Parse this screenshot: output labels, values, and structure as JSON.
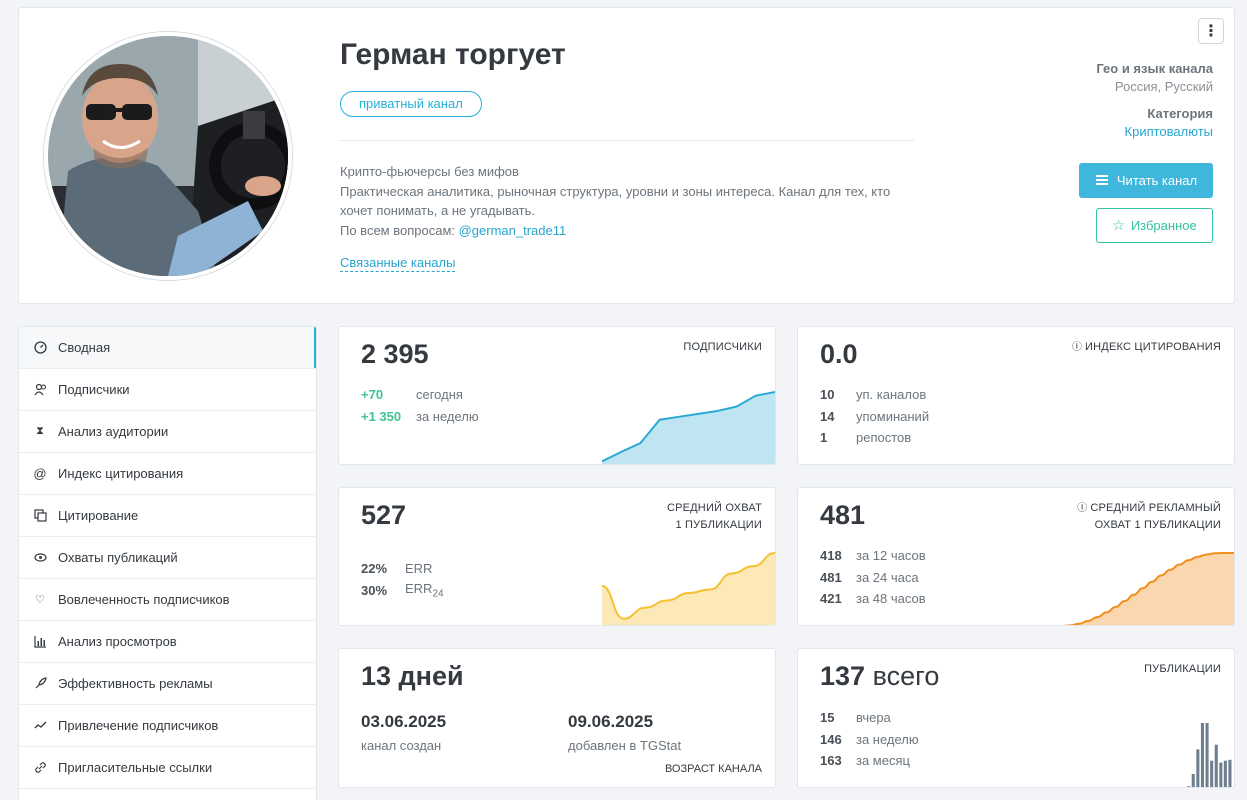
{
  "channel": {
    "title": "Герман торгует",
    "badge": "приватный канал",
    "desc_line1": "Крипто-фьючерсы без мифов",
    "desc_line2": "Практическая аналитика, рыночная структура, уровни и зоны интереса. Канал для тех, кто хочет понимать, а не угадывать.",
    "desc_contact_prefix": "По всем вопросам: ",
    "desc_contact_link": "@german_trade11",
    "related_link": "Связанные каналы",
    "geo_label": "Гео и язык канала",
    "geo_value": "Россия, Русский",
    "category_label": "Категория",
    "category_value": "Криптовалюты",
    "read_button": "Читать канал",
    "fav_button": "Избранное"
  },
  "sidebar": {
    "items": [
      {
        "label": "Сводная",
        "icon": "dashboard-icon"
      },
      {
        "label": "Подписчики",
        "icon": "users-icon"
      },
      {
        "label": "Анализ аудитории",
        "icon": "hourglass-icon"
      },
      {
        "label": "Индекс цитирования",
        "icon": "at-icon"
      },
      {
        "label": "Цитирование",
        "icon": "copy-icon"
      },
      {
        "label": "Охваты публикаций",
        "icon": "eye-icon"
      },
      {
        "label": "Вовлеченность подписчиков",
        "icon": "heart-icon"
      },
      {
        "label": "Анализ просмотров",
        "icon": "bar-chart-icon"
      },
      {
        "label": "Эффективность рекламы",
        "icon": "rocket-icon"
      },
      {
        "label": "Привлечение подписчиков",
        "icon": "trend-icon"
      },
      {
        "label": "Пригласительные ссылки",
        "icon": "link-icon"
      }
    ]
  },
  "subscribers": {
    "value": "2 395",
    "title": "подписчики",
    "rows": [
      {
        "n": "+70",
        "t": "сегодня"
      },
      {
        "n": "+1 350",
        "t": "за неделю"
      }
    ],
    "trend": [
      0.05,
      0.18,
      0.3,
      0.62,
      0.66,
      0.7,
      0.74,
      0.8,
      0.95,
      1.0
    ]
  },
  "citation": {
    "value": "0.0",
    "title": "индекс цитирования",
    "rows": [
      {
        "n": "10",
        "t": "уп. каналов"
      },
      {
        "n": "14",
        "t": "упоминаний"
      },
      {
        "n": "1",
        "t": "репостов"
      }
    ]
  },
  "reach": {
    "value": "527",
    "title_line1": "средний охват",
    "title_line2": "1 публикации",
    "rows": [
      {
        "n": "22%",
        "t": "ERR"
      },
      {
        "n": "30%",
        "t": "ERR",
        "sub": "24"
      }
    ],
    "trend": [
      0.55,
      0.1,
      0.25,
      0.35,
      0.45,
      0.5,
      0.72,
      0.82,
      1.0
    ]
  },
  "ad_reach": {
    "value": "481",
    "title_line1": "средний рекламный",
    "title_line2": "охват 1 публикации",
    "rows": [
      {
        "n": "418",
        "t": "за 12 часов"
      },
      {
        "n": "481",
        "t": "за 24 часа"
      },
      {
        "n": "421",
        "t": "за 48 часов"
      }
    ]
  },
  "age": {
    "value": "13 дней",
    "created_date": "03.06.2025",
    "created_label": "канал создан",
    "added_date": "09.06.2025",
    "added_label": "добавлен в TGStat",
    "title": "возраст канала"
  },
  "posts": {
    "value": "137",
    "value_suffix": "всего",
    "title": "публикации",
    "rows": [
      {
        "n": "15",
        "t": "вчера"
      },
      {
        "n": "146",
        "t": "за неделю"
      },
      {
        "n": "163",
        "t": "за месяц"
      }
    ],
    "bars": [
      0,
      0,
      0,
      0,
      0,
      0,
      0,
      0,
      0,
      0,
      0,
      0,
      0,
      0,
      0,
      0,
      0,
      0,
      0,
      0,
      0,
      0,
      0,
      0,
      1,
      0,
      3,
      16,
      42,
      70,
      70,
      30,
      47,
      28,
      30,
      31
    ]
  },
  "colors": {
    "accent": "#27b0d9",
    "green": "#3ec48f",
    "blue_chart": "#2ba9d6",
    "yellow_chart": "#f5c131",
    "orange_chart": "#f28d1a",
    "bar_chart": "#6f7f90"
  }
}
